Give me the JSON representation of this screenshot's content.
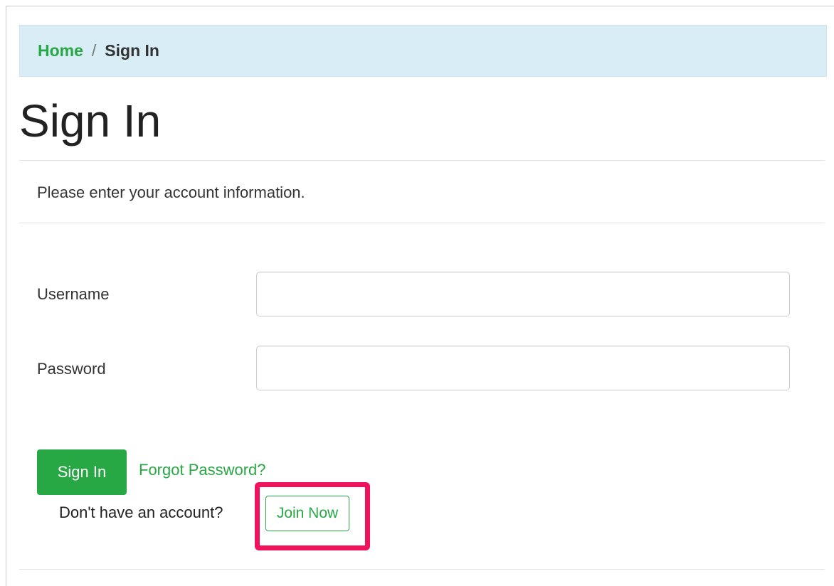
{
  "breadcrumb": {
    "home": "Home",
    "separator": "/",
    "current": "Sign In"
  },
  "page": {
    "title": "Sign In",
    "intro": "Please enter your account information."
  },
  "form": {
    "username_label": "Username",
    "username_value": "",
    "password_label": "Password",
    "password_value": "",
    "signin_button": "Sign In",
    "forgot_link": "Forgot Password?",
    "no_account_text": "Don't have an account?",
    "join_button": "Join Now"
  },
  "colors": {
    "accent_green": "#28a745",
    "breadcrumb_bg": "#d9edf7",
    "highlight_box": "#f0125a"
  }
}
